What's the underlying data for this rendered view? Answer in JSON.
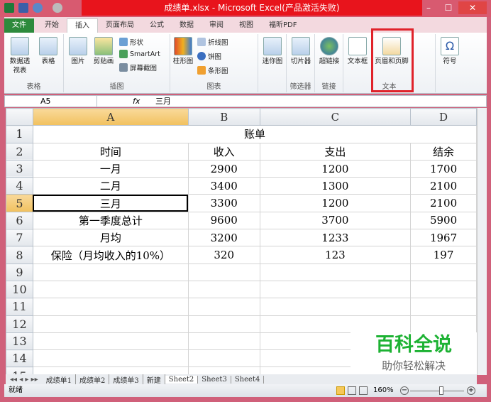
{
  "window": {
    "title": "成绩单.xlsx - Microsoft Excel(产品激活失败)",
    "minimize": "–",
    "maximize": "☐",
    "close": "✕"
  },
  "tabs": [
    "文件",
    "开始",
    "插入",
    "页面布局",
    "公式",
    "数据",
    "审阅",
    "视图",
    "福昕PDF"
  ],
  "ribbon": {
    "groups": [
      "表格",
      "插图",
      "图表",
      "筛选器",
      "链接",
      "文本"
    ],
    "buttons": {
      "pivot": "数据透视表",
      "table": "表格",
      "picture": "图片",
      "clipart": "剪贴画",
      "shape": "形状",
      "smartart": "SmartArt",
      "screenshot": "屏幕截图",
      "column": "柱形图",
      "line": "折线图",
      "pie": "饼图",
      "bar": "条形图",
      "sparkline": "迷你图",
      "slicer": "切片器",
      "hyperlink": "超链接",
      "textbox": "文本框",
      "headerfooter": "页眉和页脚",
      "symbol": "符号"
    }
  },
  "formula_bar": {
    "name_box": "A5",
    "fx": "fx",
    "value": "三月"
  },
  "sheet": {
    "columns": [
      "A",
      "B",
      "C",
      "D"
    ],
    "rows": [
      [
        "账单",
        "",
        "",
        ""
      ],
      [
        "时间",
        "收入",
        "支出",
        "结余"
      ],
      [
        "一月",
        "2900",
        "1200",
        "1700"
      ],
      [
        "二月",
        "3400",
        "1300",
        "2100"
      ],
      [
        "三月",
        "3300",
        "1200",
        "2100"
      ],
      [
        "第一季度总计",
        "9600",
        "3700",
        "5900"
      ],
      [
        "月均",
        "3200",
        "1233",
        "1967"
      ],
      [
        "保险（月均收入的10%）",
        "320",
        "123",
        "197"
      ],
      [
        "",
        "",
        "",
        ""
      ],
      [
        "",
        "",
        "",
        ""
      ],
      [
        "",
        "",
        "",
        ""
      ],
      [
        "",
        "",
        "",
        ""
      ],
      [
        "",
        "",
        "",
        ""
      ],
      [
        "",
        "",
        "",
        ""
      ],
      [
        "",
        "",
        "",
        ""
      ]
    ],
    "selected": "A5"
  },
  "sheet_tabs": [
    "成绩单1",
    "成绩单2",
    "成绩单3",
    "新建",
    "Sheet2",
    "Sheet3",
    "Sheet4"
  ],
  "active_sheet": "Sheet2",
  "status": {
    "ready": "就绪",
    "zoom": "160%"
  },
  "watermark": {
    "title": "百科全说",
    "subtitle": "助你轻松解决"
  }
}
